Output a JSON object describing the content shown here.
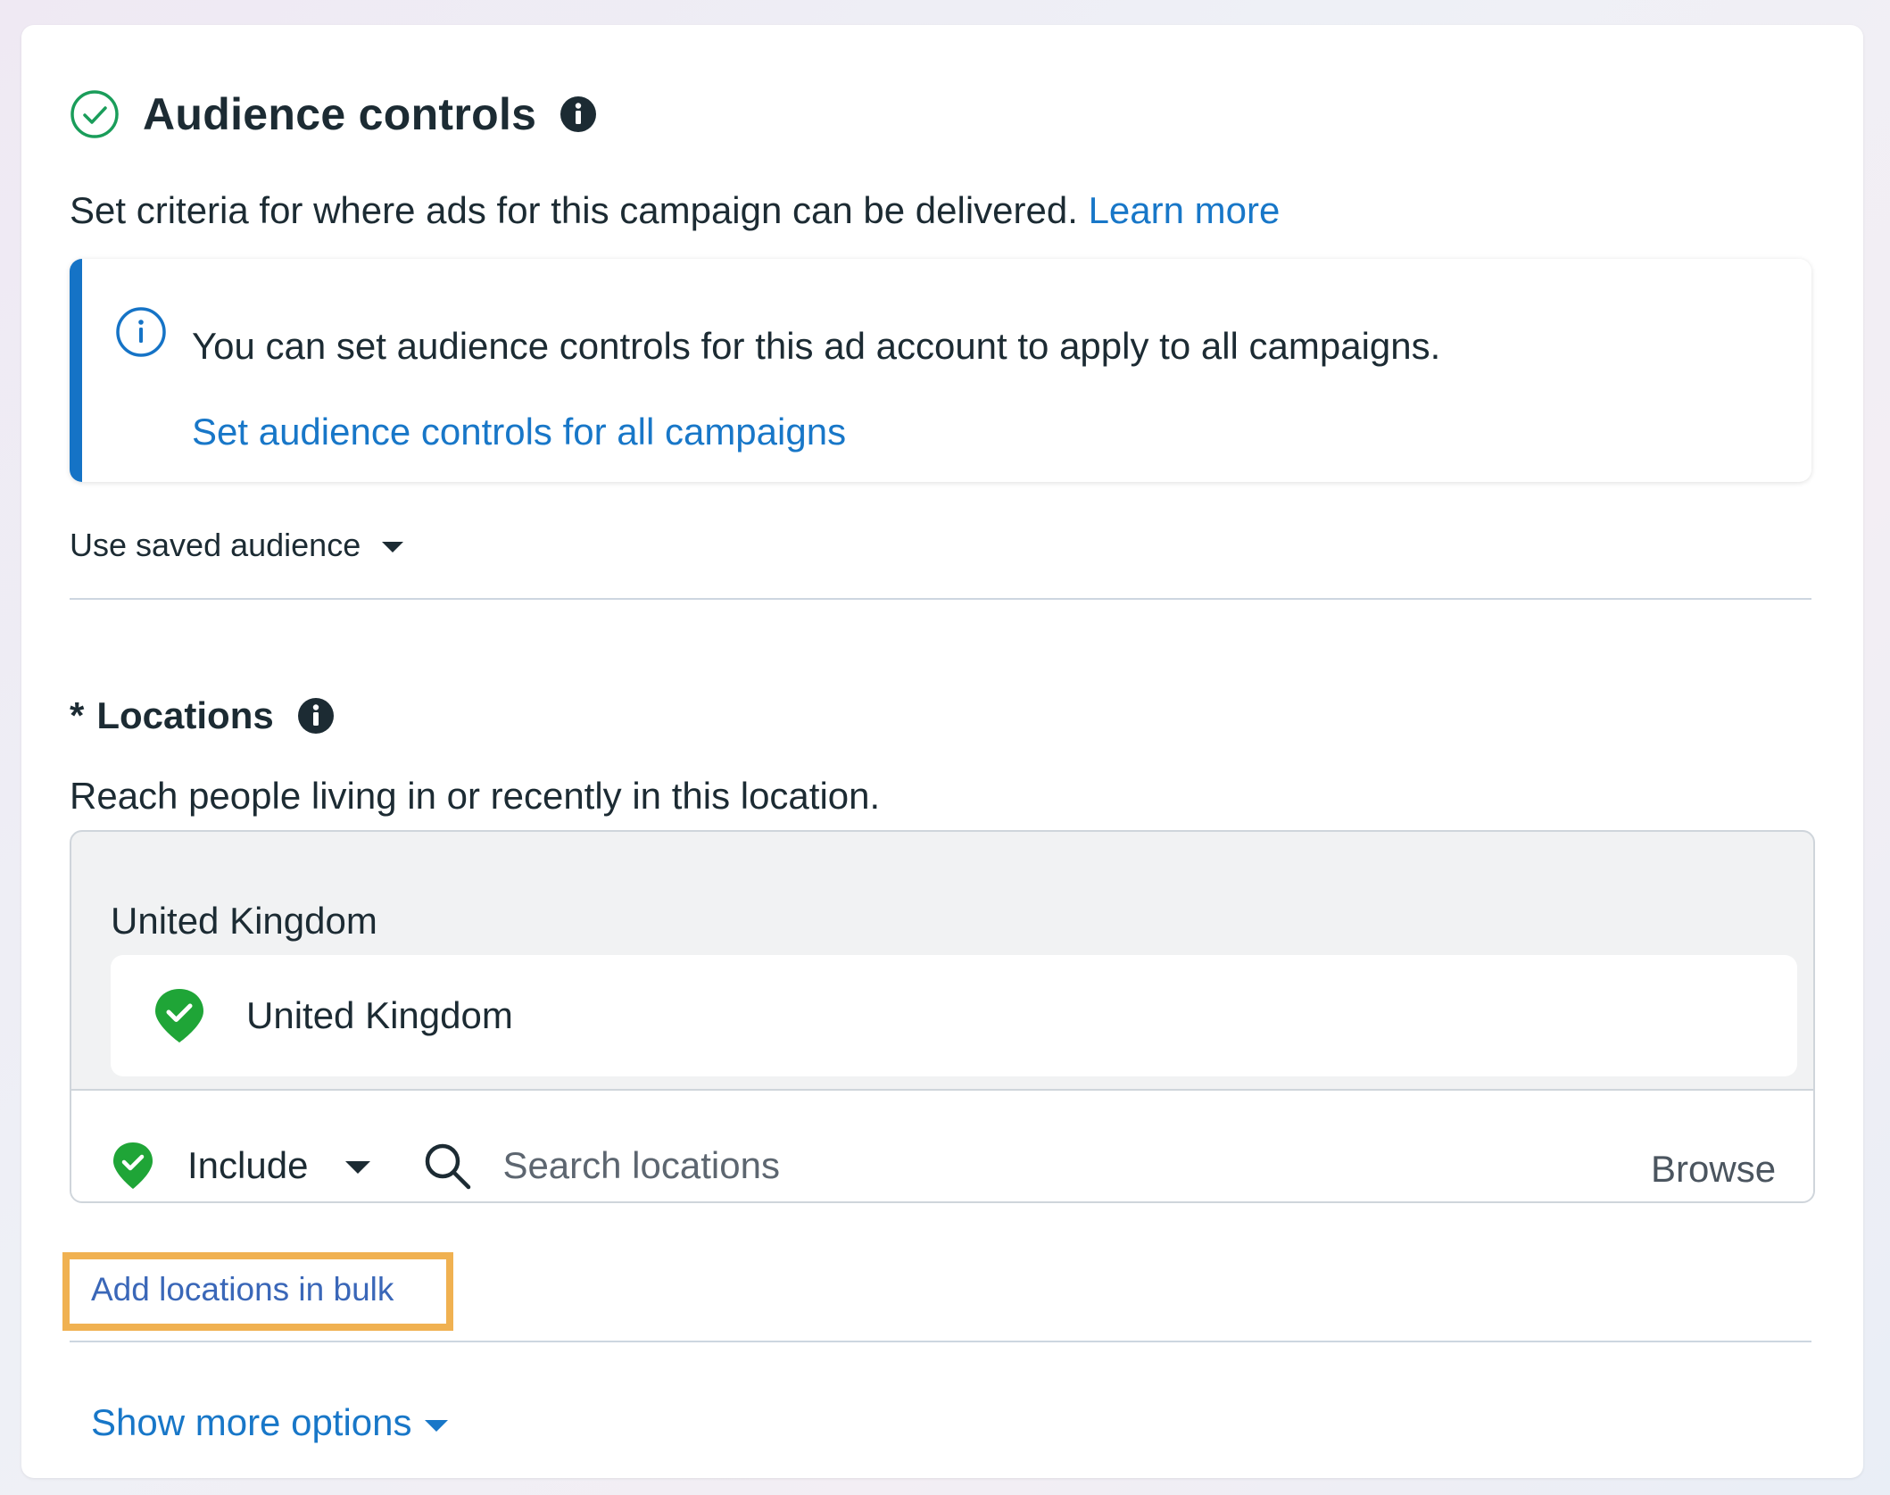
{
  "header": {
    "title": "Audience controls",
    "subtitle": "Set criteria for where ads for this campaign can be delivered.",
    "learn_more": "Learn more"
  },
  "banner": {
    "text": "You can set audience controls for this ad account to apply to all campaigns.",
    "link": "Set audience controls for all campaigns",
    "accent_color": "#1573c6"
  },
  "saved_audience": {
    "label": "Use saved audience"
  },
  "locations": {
    "required_marker": "*",
    "title": "Locations",
    "description": "Reach people living in or recently in this location.",
    "group_title": "United Kingdom",
    "selected": [
      {
        "label": "United Kingdom",
        "icon": "location-pin-check-icon"
      }
    ],
    "include_label": "Include",
    "search_placeholder": "Search locations",
    "browse_label": "Browse",
    "bulk_link": "Add locations in bulk"
  },
  "footer": {
    "show_more": "Show more options"
  },
  "colors": {
    "link": "#1877c8",
    "pin_green": "#1fa537",
    "highlight": "#f0b151"
  }
}
